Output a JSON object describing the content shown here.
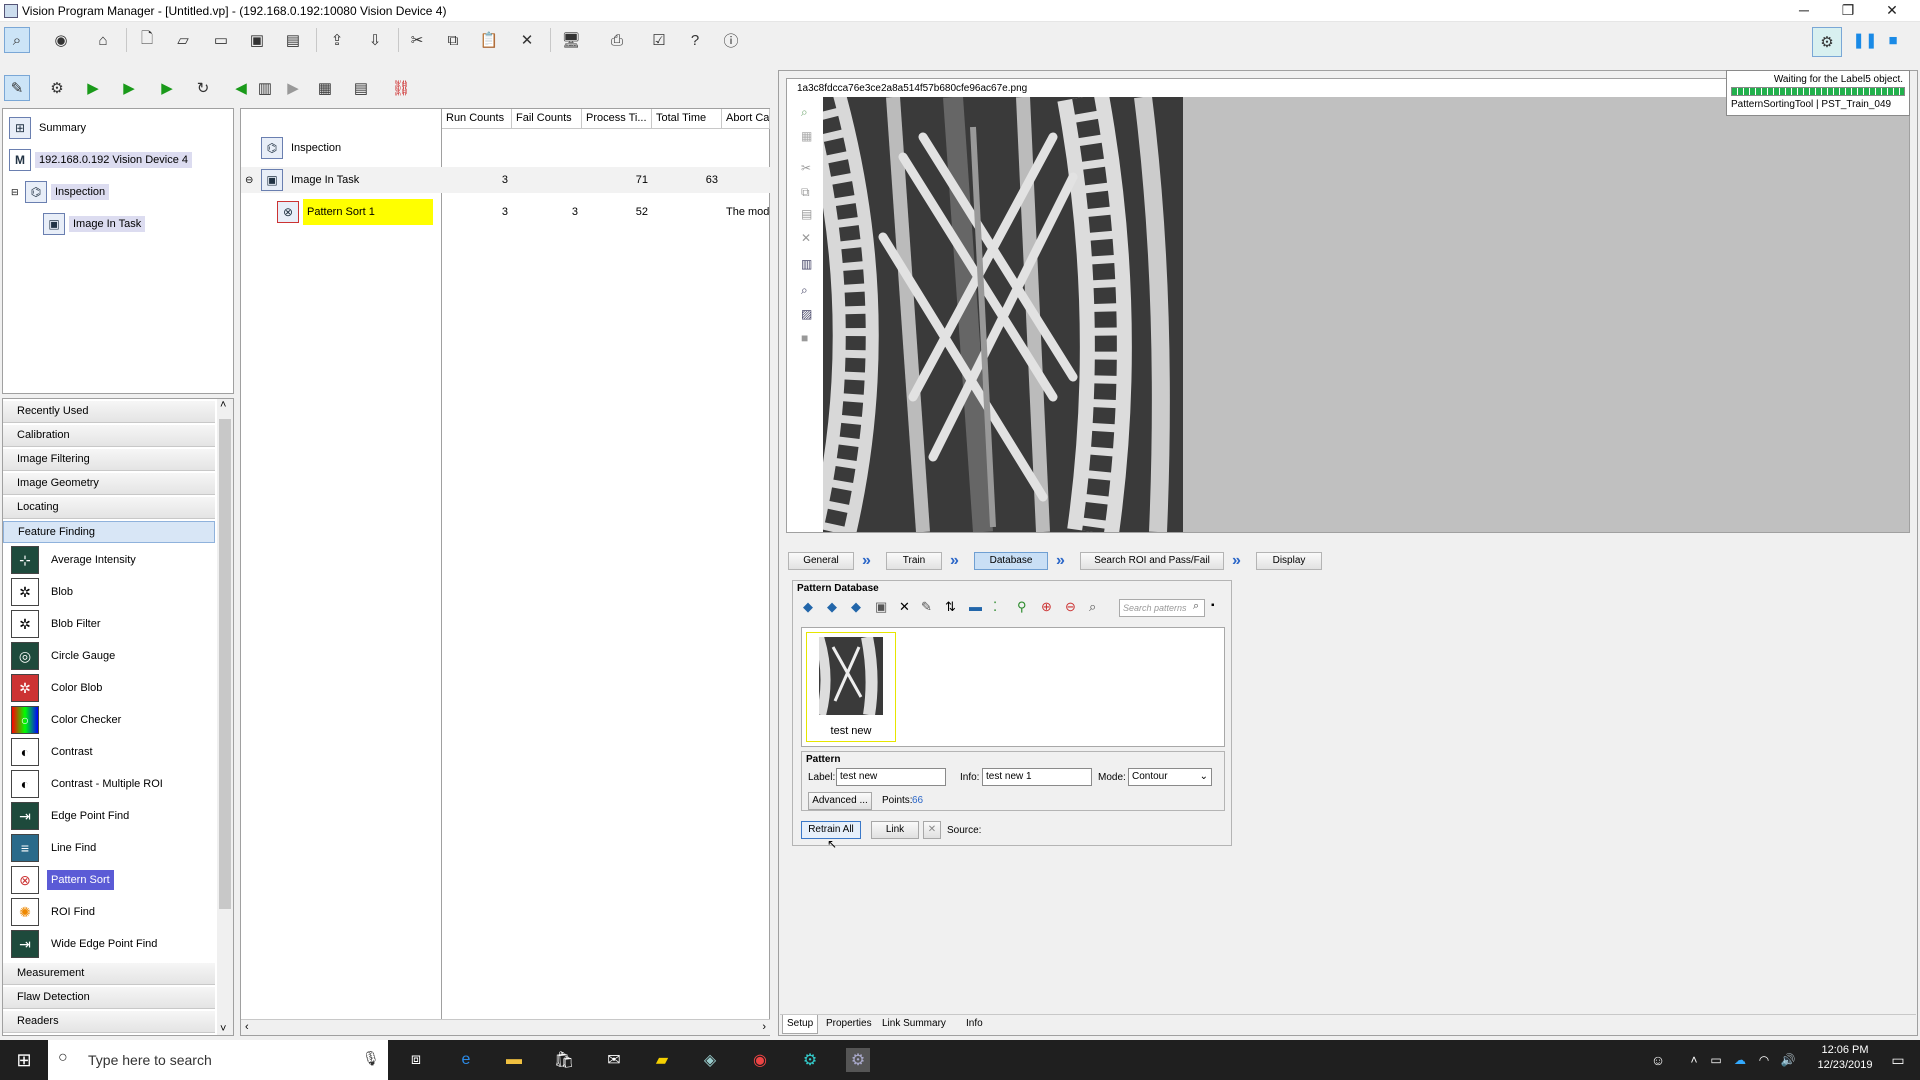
{
  "window": {
    "title": "Vision Program Manager - [Untitled.vp] - (192.168.0.192:10080 Vision Device 4)",
    "minimize": "─",
    "restore": "❐",
    "close": "✕"
  },
  "tree": {
    "items": [
      {
        "label": "Summary"
      },
      {
        "label": "192.168.0.192 Vision Device 4"
      },
      {
        "label": "Inspection"
      },
      {
        "label": "Image In Task"
      }
    ]
  },
  "grid": {
    "headers": [
      "Run Counts",
      "Fail Counts",
      "Process Ti...",
      "Total Time",
      "Abort Ca"
    ],
    "rows": [
      {
        "name": "Inspection",
        "cells": [
          "",
          "",
          "",
          "",
          ""
        ]
      },
      {
        "name": "Image In Task",
        "cells": [
          "3",
          "",
          "71",
          "63",
          ""
        ]
      },
      {
        "name": "Pattern Sort 1",
        "cells": [
          "3",
          "3",
          "52",
          "",
          "The mode"
        ]
      }
    ]
  },
  "toolbox": {
    "categories_top": [
      "Recently Used",
      "Calibration",
      "Image Filtering",
      "Image Geometry",
      "Locating",
      "Feature Finding"
    ],
    "tools": [
      "Average Intensity",
      "Blob",
      "Blob Filter",
      "Circle Gauge",
      "Color Blob",
      "Color Checker",
      "Contrast",
      "Contrast - Multiple ROI",
      "Edge Point Find",
      "Line Find",
      "Pattern Sort",
      "ROI Find",
      "Wide Edge Point Find"
    ],
    "categories_bottom": [
      "Measurement",
      "Flaw Detection",
      "Readers"
    ]
  },
  "image_view": {
    "filename": "1a3c8fdcca76e3ce2a8a514f57b680cfe96ac67e.png"
  },
  "status_popup": {
    "message": "Waiting for the Label5 object.",
    "sub": "PatternSortingTool | PST_Train_049"
  },
  "wizard": {
    "tabs": [
      "General",
      "Train",
      "Database",
      "Search ROI and Pass/Fail",
      "Display"
    ]
  },
  "pattern_db": {
    "title": "Pattern Database",
    "search_placeholder": "Search patterns",
    "thumb_label": "test new",
    "pattern_group": "Pattern",
    "label_caption": "Label:",
    "label_value": "test new",
    "info_caption": "Info:",
    "info_value": "test new 1",
    "mode_caption": "Mode:",
    "mode_value": "Contour",
    "advanced": "Advanced ...",
    "points_caption": "Points:",
    "points_value": "66",
    "retrain": "Retrain All",
    "link": "Link",
    "source_caption": "Source:"
  },
  "bottom_tabs": [
    "Setup",
    "Properties",
    "Link Summary",
    "Info"
  ],
  "taskbar": {
    "search_placeholder": "Type here to search",
    "time": "12:06 PM",
    "date": "12/23/2019"
  }
}
